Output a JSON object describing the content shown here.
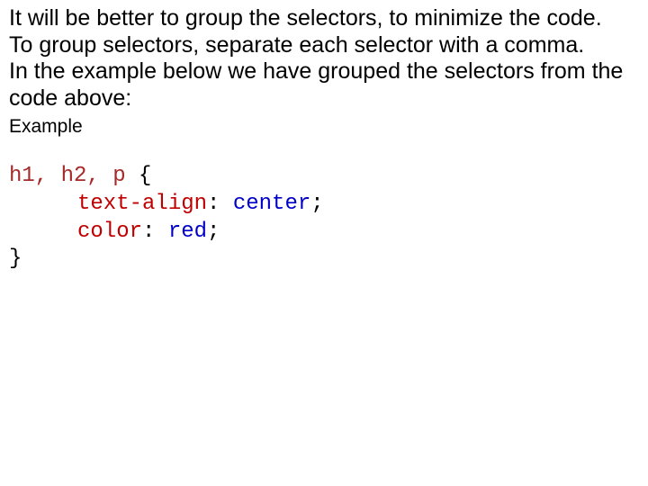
{
  "intro": {
    "line1": "It will be better to group the selectors, to minimize the code.",
    "line2": "To group selectors, separate each selector with a comma.",
    "line3": "In the example below we have grouped the selectors from the code above:"
  },
  "example_label": "Example",
  "code": {
    "selectors": "h1, h2, p",
    "open": " {",
    "decl1": {
      "prop": "text-align",
      "colon": ": ",
      "val": "center",
      "semi": ";"
    },
    "decl2": {
      "prop": "color",
      "colon": ": ",
      "val": "red",
      "semi": ";"
    },
    "close": "}"
  }
}
